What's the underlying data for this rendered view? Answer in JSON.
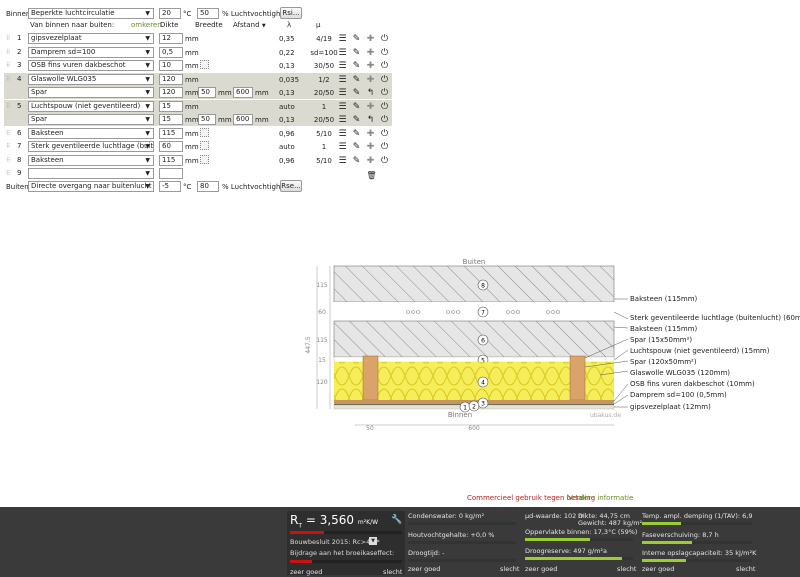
{
  "top_bar": {
    "inside_label": "Binnen:",
    "inside_climate": "Beperkte luchtcirculatie",
    "inside_temp": "20",
    "inside_temp_unit": "°C",
    "inside_humidity": "50",
    "humidity_unit": "% Luchtvochtigheid",
    "rsi_button": "Rsi..."
  },
  "headers": {
    "order": "Van binnen naar buiten:",
    "reverse": "omkeren",
    "thickness": "Dikte",
    "width": "Breedte",
    "distance": "Afstand",
    "lambda": "λ",
    "mu": "μ"
  },
  "units": {
    "mm": "mm"
  },
  "layers": [
    {
      "num": "1",
      "material": "gipsvezelplaat",
      "thickness": "12",
      "lambda": "0,35",
      "mu": "4/19",
      "highlight": false,
      "sub": false
    },
    {
      "num": "2",
      "material": "Damprem sd=100",
      "thickness": "0,5",
      "lambda": "0,22",
      "mu": "sd=100",
      "highlight": false,
      "sub": false
    },
    {
      "num": "3",
      "material": "OSB fins vuren dakbeschot",
      "thickness": "10",
      "lambda": "0,13",
      "mu": "30/50",
      "highlight": false,
      "sub": false
    },
    {
      "num": "4",
      "material": "Glaswolle WLG035",
      "thickness": "120",
      "lambda": "0,035",
      "mu": "1/2",
      "highlight": true,
      "sub": false
    },
    {
      "num": "",
      "material": "Spar",
      "thickness": "120",
      "width": "50",
      "distance": "600",
      "lambda": "0,13",
      "mu": "20/50",
      "highlight": true,
      "sub": true
    },
    {
      "num": "5",
      "material": "Luchtspouw (niet geventileerd)",
      "thickness": "15",
      "lambda": "auto",
      "mu": "1",
      "highlight": true,
      "sub": false
    },
    {
      "num": "",
      "material": "Spar",
      "thickness": "15",
      "width": "50",
      "distance": "600",
      "lambda": "0,13",
      "mu": "20/50",
      "highlight": true,
      "sub": true
    },
    {
      "num": "6",
      "material": "Baksteen",
      "thickness": "115",
      "lambda": "0,96",
      "mu": "5/10",
      "highlight": false,
      "sub": false
    },
    {
      "num": "7",
      "material": "Sterk geventileerde luchtlage (buiten",
      "thickness": "60",
      "lambda": "auto",
      "mu": "1",
      "highlight": false,
      "sub": false
    },
    {
      "num": "8",
      "material": "Baksteen",
      "thickness": "115",
      "lambda": "0,96",
      "mu": "5/10",
      "highlight": false,
      "sub": false
    },
    {
      "num": "9",
      "material": "",
      "thickness": "",
      "lambda": "",
      "mu": "",
      "highlight": false,
      "sub": false,
      "empty": true
    }
  ],
  "bottom_bar": {
    "outside_label": "Buiten:",
    "outside_climate": "Directe overgang naar buitenlucht",
    "outside_temp": "-5",
    "outside_temp_unit": "°C",
    "outside_humidity": "80",
    "humidity_unit": "% Luchtvochtigheid",
    "rse_button": "Rse..."
  },
  "drawing": {
    "top_label": "Buiten",
    "bottom_label": "Binnen",
    "watermark": "ubakus.de",
    "total_dim": "447,5",
    "dims_left": [
      "115",
      "60",
      "115",
      "15",
      "120"
    ],
    "dims_bottom": [
      "50",
      "600"
    ],
    "labels": [
      "Baksteen (115mm)",
      "Sterk geventileerde luchtlage (buitenlucht) (60mm)",
      "Baksteen (115mm)",
      "Spar (15x50mm²)",
      "Luchtspouw (niet geventileerd) (15mm)",
      "Spar (120x50mm²)",
      "Glaswolle WLG035 (120mm)",
      "OSB fins vuren dakbeschot (10mm)",
      "Damprem sd=100 (0,5mm)",
      "gipsvezelplaat (12mm)"
    ]
  },
  "footer": {
    "commercial": "Commercieel gebruik tegen betaling",
    "more_info": "Verdere informatie"
  },
  "status": {
    "rt_label": "R",
    "rt_sub": "T",
    "rt_eq": " = 3,560",
    "rt_unit": "m²K/W",
    "regulation": "Bouwbesluit 2015: Rc>4,5*",
    "greenhouse": "Bijdrage aan het broeikaseffect:",
    "scale_good": "zeer goed",
    "scale_bad": "slecht",
    "condensate": "Condenswater: 0 kg/m²",
    "wood_moisture": "Houtvochtgehalte: +0,0 %",
    "drying": "Droogtijd: -",
    "sd_value": "μd-waarde: 102 m",
    "thickness": "Dikte: 44,75 cm",
    "weight": "Gewicht: 487 kg/m²",
    "surface_temp": "Oppervlakte binnen: 17,3°C (59%)",
    "drying_reserve": "Droogreserve: 497 g/m²a",
    "temp_damping": "Temp. ampl. demping (1/TAV): 6,9",
    "phase_shift": "Faseverschuiving: 8,7 h",
    "heat_capacity": "Interne opslagcapaciteit: 35 kJ/m²K"
  },
  "colors": {
    "accent_red": "#cc1111",
    "bar_green": "#9acd32",
    "insulation_yellow": "#f5ee5a",
    "wood_tan": "#d9a36a",
    "status_bg": "#3a3a3a"
  }
}
